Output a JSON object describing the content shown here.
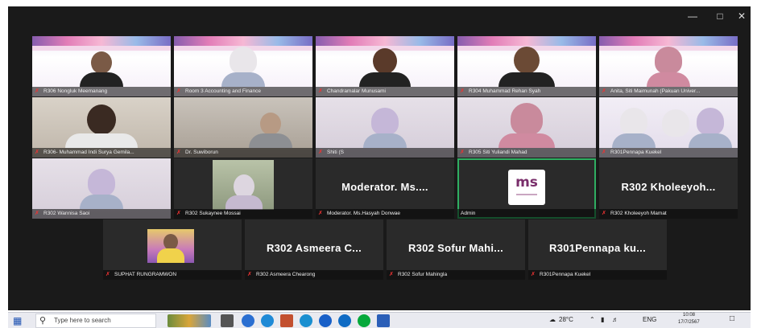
{
  "window": {
    "min": "—",
    "max": "□",
    "close": "✕"
  },
  "tiles": [
    {
      "label": "R306 Nongluk Meemanang",
      "kind": "video"
    },
    {
      "label": "Room 3 Accounting and Finance",
      "kind": "video"
    },
    {
      "label": "Chandramalar Munusami",
      "kind": "video"
    },
    {
      "label": "R304 Muhammad Rehan Syah",
      "kind": "video"
    },
    {
      "label": "Anita, Siti Maimunah (Pakuan Univer...",
      "kind": "video"
    },
    {
      "label": "R306- Muhammad Indi Surya Gemila...",
      "kind": "video"
    },
    {
      "label": "Dr. Suwiborun",
      "kind": "video"
    },
    {
      "label": "Shiti (S",
      "kind": "video"
    },
    {
      "label": "R305 Siti Yuliandi Mahad",
      "kind": "video"
    },
    {
      "label": "R301Pennapa Kuekel",
      "kind": "video"
    },
    {
      "label": "R302 Wannisa Saoi",
      "kind": "video"
    },
    {
      "label": "R302 Sukaynee Mossai",
      "kind": "video"
    },
    {
      "label": "Moderator. Ms.Hasyah Donwae",
      "kind": "text",
      "big": "Moderator. Ms...."
    },
    {
      "label": "Admin",
      "kind": "logo",
      "logo_text": "ms"
    },
    {
      "label": "R302 Kholeeyoh Mamat",
      "kind": "text",
      "big": "R302 Kholeeyoh..."
    },
    {
      "label": "SUPHAT RUNGRAMWON",
      "kind": "thumb"
    },
    {
      "label": "R302 Asmeera Chearong",
      "kind": "text",
      "big": "R302 Asmeera C..."
    },
    {
      "label": "R302 Sofur Mahingla",
      "kind": "text",
      "big": "R302 Sofur Mahi..."
    },
    {
      "label": "R301Pennapa Kuekel",
      "kind": "text",
      "big": "R301Pennapa ku..."
    }
  ],
  "taskbar": {
    "search_placeholder": "Type here to search",
    "temperature": "28°C",
    "lang": "ENG",
    "time": "10:08",
    "date": "17/7/2567"
  },
  "colors": {
    "active_speaker": "#2fae62",
    "mic_muted": "#e33333"
  }
}
